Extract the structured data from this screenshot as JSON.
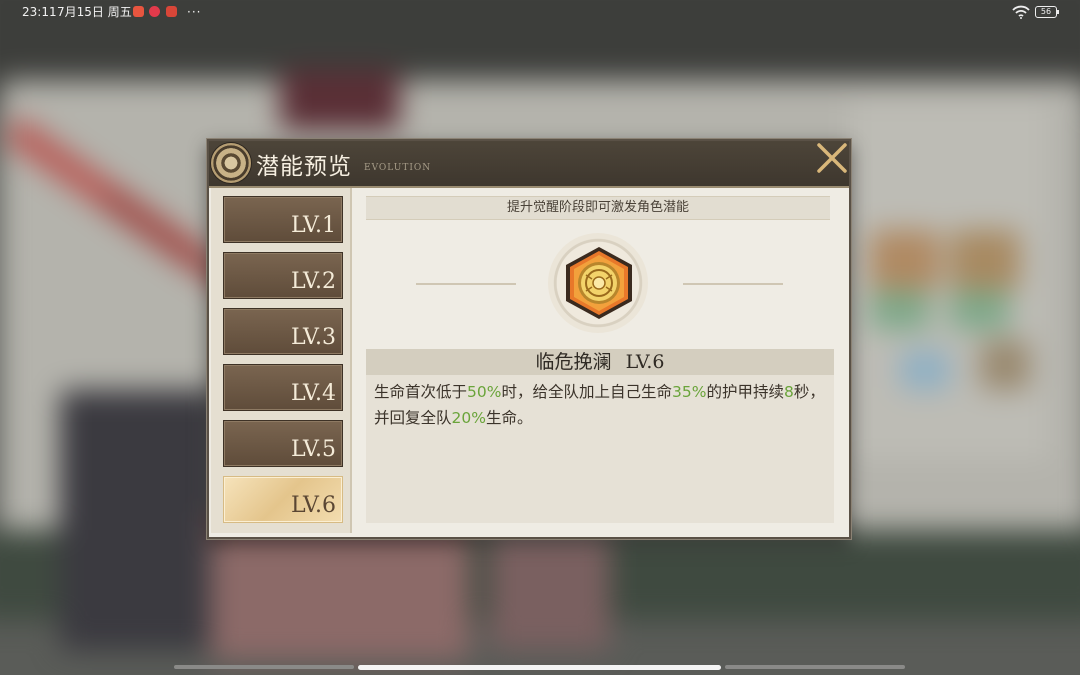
{
  "status_bar": {
    "time": "23:11",
    "date": "7月15日 周五",
    "more": "···",
    "battery": "56"
  },
  "dialog": {
    "title": "潜能预览",
    "subtitle": "EVOLUTION",
    "tabs": [
      {
        "label": "LV.1",
        "active": false
      },
      {
        "label": "LV.2",
        "active": false
      },
      {
        "label": "LV.3",
        "active": false
      },
      {
        "label": "LV.4",
        "active": false
      },
      {
        "label": "LV.5",
        "active": false
      },
      {
        "label": "LV.6",
        "active": true
      }
    ],
    "hint": "提升觉醒阶段即可激发角色潜能",
    "skill": {
      "name": "临危挽澜",
      "level": "LV.6",
      "desc": {
        "p1": "生命首次低于",
        "v1": "50%",
        "p2": "时，给全队加上自己生命",
        "v2": "35%",
        "p3": "的护甲持续",
        "v3": "8",
        "p4": "秒，并回复全队",
        "v4": "20%",
        "p5": "生命。"
      }
    }
  },
  "colors": {
    "highlight": "#6aa43a",
    "header": "#4d4539",
    "active_tab": "#e4c58c"
  }
}
